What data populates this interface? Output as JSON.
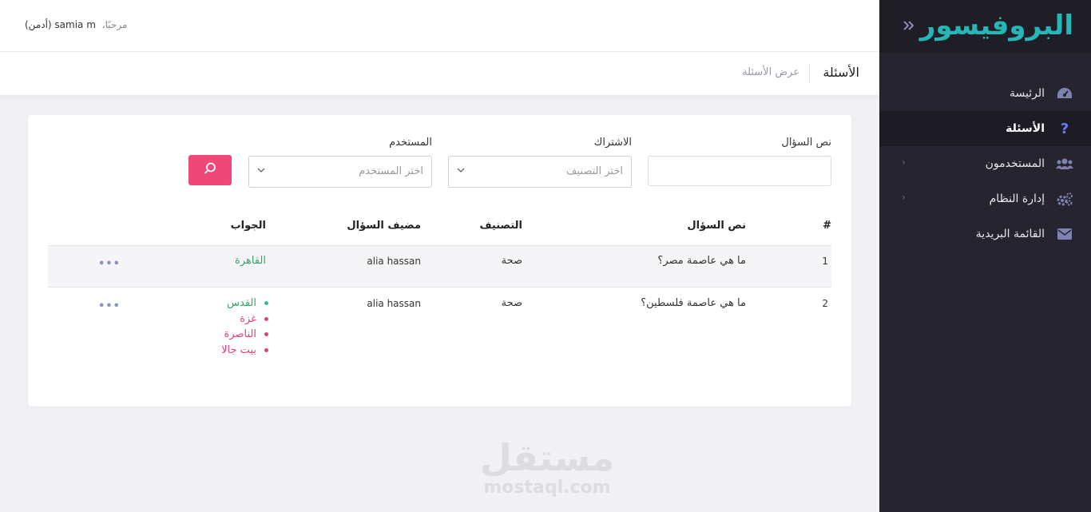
{
  "brand": "البروفيسور",
  "header": {
    "hello": "مرحبًا،",
    "user": "samia m (أدمن)"
  },
  "page": {
    "title": "الأسئلة",
    "subtitle": "عرض الأسئلة"
  },
  "sidebar": {
    "items": [
      {
        "label": "الرئيسة",
        "icon": "dashboard-icon"
      },
      {
        "label": "الأسئلة",
        "icon": "question-icon",
        "active": true
      },
      {
        "label": "المستخدمون",
        "icon": "users-icon"
      },
      {
        "label": "إدارة النظام",
        "icon": "cogs-icon"
      },
      {
        "label": "القائمة البريدية",
        "icon": "envelope-icon"
      }
    ]
  },
  "filters": {
    "question_label": "نص السؤال",
    "subscription_label": "الاشتراك",
    "subscription_placeholder": "اختر التصنيف",
    "user_label": "المستخدم",
    "user_placeholder": "اختر المستخدم"
  },
  "table": {
    "headers": [
      "#",
      "نص السؤال",
      "التصنيف",
      "مضيف السؤال",
      "الجواب"
    ],
    "rows": [
      {
        "num": "1",
        "question": "ما هي عاصمة مصر؟",
        "category": "صحة",
        "author": "alia hassan",
        "answer": "القاهرة"
      },
      {
        "num": "2",
        "question": "ما هي عاصمة فلسطين؟",
        "category": "صحة",
        "author": "alia hassan",
        "answers": [
          "القدس",
          "غزة",
          "الناصرة",
          "بيت جالا"
        ]
      }
    ],
    "more": "•••"
  },
  "colors": {
    "brand": "#27b6b6",
    "accent": "#f04779",
    "correct": "#2fa86a",
    "wrong": "#e23f72",
    "sidebar_bg": "#26252f"
  },
  "watermark": {
    "arabic": "مستقل",
    "latin": "mostaql.com"
  }
}
